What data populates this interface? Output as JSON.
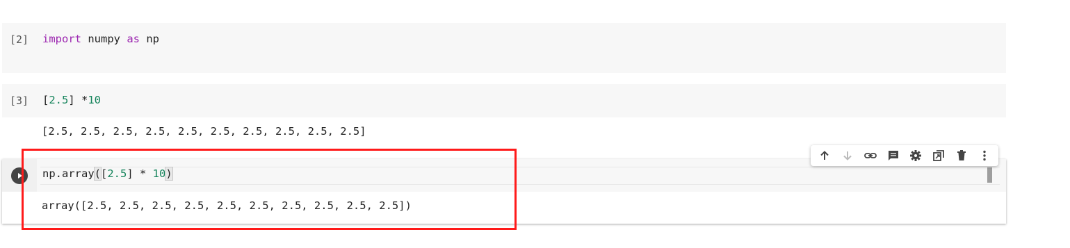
{
  "previous_fragment": "…",
  "cells": {
    "cell2": {
      "exec_count": "[2]",
      "code": {
        "kw1": "import",
        "t1": " numpy ",
        "kw2": "as",
        "t2": " np"
      }
    },
    "cell3": {
      "exec_count": "[3]",
      "code": {
        "p1": "[",
        "n1": "2.5",
        "p2": "] *",
        "n2": "10"
      },
      "output": "[2.5, 2.5, 2.5, 2.5, 2.5, 2.5, 2.5, 2.5, 2.5, 2.5]"
    },
    "active": {
      "code": {
        "t1": "np.array",
        "lp": "(",
        "t2": "[",
        "n1": "2.5",
        "t3": "] * ",
        "n2": "10",
        "rp": ")"
      },
      "output": "array([2.5, 2.5, 2.5, 2.5, 2.5, 2.5, 2.5, 2.5, 2.5, 2.5])"
    }
  },
  "toolbar": {
    "buttons": [
      {
        "icon": "move-up-icon"
      },
      {
        "icon": "move-down-icon"
      },
      {
        "icon": "link-icon"
      },
      {
        "icon": "comment-icon"
      },
      {
        "icon": "settings-icon"
      },
      {
        "icon": "mirror-cell-icon"
      },
      {
        "icon": "delete-icon"
      },
      {
        "icon": "more-vert-icon"
      }
    ]
  },
  "colors": {
    "keyword": "#9c27b0",
    "number": "#13835a",
    "highlight_box": "#ff1a1a",
    "cell_bg": "#f7f7f7"
  }
}
